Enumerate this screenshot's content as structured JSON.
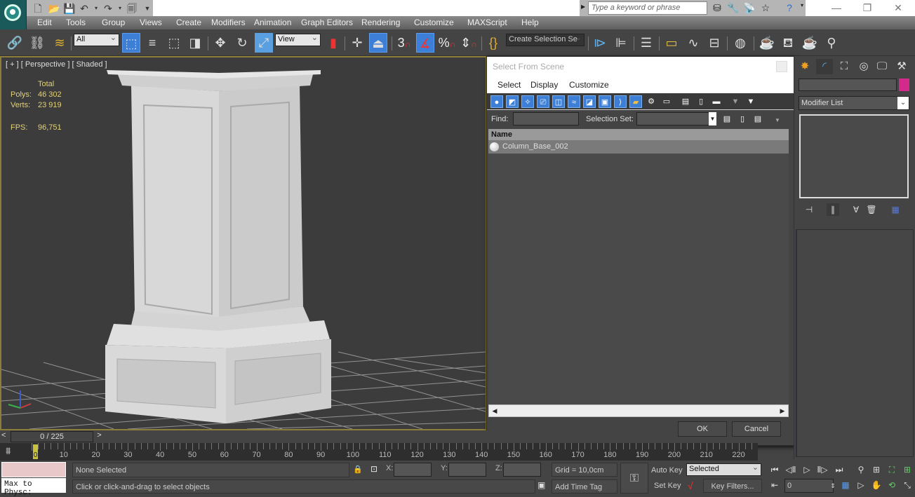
{
  "window": {
    "search_placeholder": "Type a keyword or phrase",
    "minimize": "—",
    "restore": "❐",
    "close": "✕"
  },
  "quick_access": [
    "new-icon",
    "open-icon",
    "save-icon",
    "undo-icon",
    "redo-icon",
    "project-icon"
  ],
  "menubar": [
    "Edit",
    "Tools",
    "Group",
    "Views",
    "Create",
    "Modifiers",
    "Animation",
    "Graph Editors",
    "Rendering",
    "Customize",
    "MAXScript",
    "Help"
  ],
  "toolbar": {
    "selection_filter": "All",
    "reference_coord": "View",
    "named_selection": "Create Selection Se",
    "snap_label": "3"
  },
  "viewport": {
    "label": "[ + ] [ Perspective ] [ Shaded ]",
    "stats": {
      "header": "Total",
      "polys_label": "Polys:",
      "polys_value": "46 302",
      "verts_label": "Verts:",
      "verts_value": "23 919",
      "fps_label": "FPS:",
      "fps_value": "96,751"
    }
  },
  "dialog": {
    "title": "Select From Scene",
    "menu": [
      "Select",
      "Display",
      "Customize"
    ],
    "find_label": "Find:",
    "find_value": "",
    "selection_set_label": "Selection Set:",
    "selection_set_value": "",
    "column_header": "Name",
    "rows": [
      {
        "name": "Column_Base_002"
      }
    ],
    "ok_label": "OK",
    "cancel_label": "Cancel"
  },
  "command_panel": {
    "object_name": "",
    "object_color": "#d42a8c",
    "modifier_list": "Modifier List"
  },
  "time_slider": {
    "prev": "<",
    "position": "0 / 225",
    "next": ">",
    "current_frame": 0,
    "total_frames": 225,
    "tick_labels": [
      "0",
      "10",
      "20",
      "30",
      "40",
      "50",
      "60",
      "70",
      "80",
      "90",
      "100",
      "110",
      "120",
      "130",
      "140",
      "150",
      "160",
      "170",
      "180",
      "190",
      "200",
      "210",
      "220"
    ]
  },
  "status": {
    "maxscript_listener": "Max to Physc:",
    "selection": "None Selected",
    "prompt": "Click or click-and-drag to select objects",
    "x_label": "X:",
    "y_label": "Y:",
    "z_label": "Z:",
    "x_value": "",
    "y_value": "",
    "z_value": "",
    "grid": "Grid = 10,0cm",
    "add_time_tag": "Add Time Tag",
    "auto_key": "Auto Key",
    "set_key": "Set Key",
    "key_mode": "Selected",
    "key_filters": "Key Filters...",
    "frame_value": "0"
  }
}
